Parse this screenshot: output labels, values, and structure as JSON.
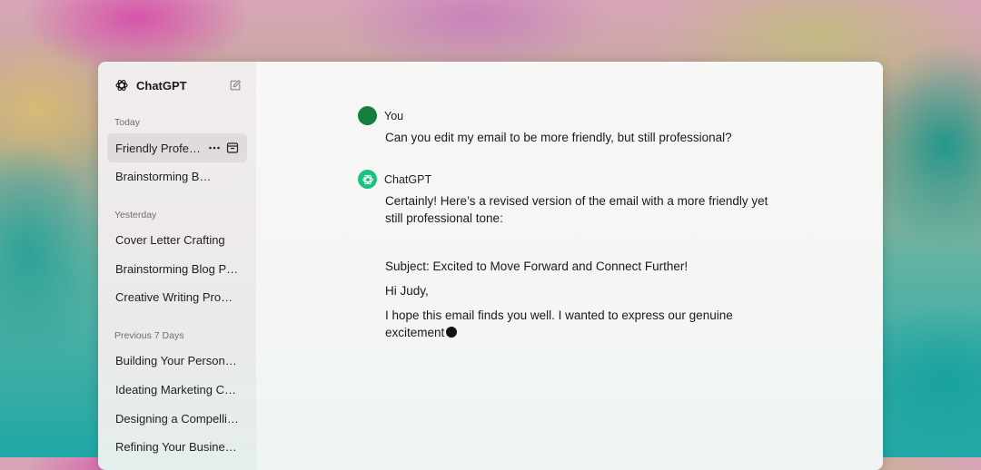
{
  "app": {
    "title": "ChatGPT"
  },
  "sidebar": {
    "sections": [
      {
        "label": "Today",
        "items": [
          {
            "label": "Friendly Professional Email",
            "active": true
          },
          {
            "label": "Brainstorming Blog Ideas"
          }
        ]
      },
      {
        "label": "Yesterday",
        "items": [
          {
            "label": "Cover Letter Crafting"
          },
          {
            "label": "Brainstorming Blog Post Ideas"
          },
          {
            "label": "Creative Writing Prompts"
          }
        ]
      },
      {
        "label": "Previous 7 Days",
        "items": [
          {
            "label": "Building Your Personal Brand"
          },
          {
            "label": "Ideating Marketing Campaigns"
          },
          {
            "label": "Designing a Compelling Pitch"
          },
          {
            "label": "Refining Your Business Plan"
          }
        ]
      }
    ]
  },
  "conversation": {
    "user": {
      "author": "You",
      "text": "Can you edit my email to be more friendly, but still professional?",
      "avatar_color": "#15803d"
    },
    "assistant": {
      "author": "ChatGPT",
      "avatar_color": "#19c37d",
      "intro": "Certainly! Here’s a revised version of the email with a more friendly yet still professional tone:",
      "subject": "Subject: Excited to Move Forward and Connect Further!",
      "greeting": "Hi Judy,",
      "paragraph": "I hope this email finds you well. I wanted to express our genuine excitement"
    }
  },
  "icons": {
    "logo": "openai-logo-icon",
    "new_chat": "edit-icon",
    "more": "more-horizontal-icon",
    "archive": "archive-icon"
  }
}
